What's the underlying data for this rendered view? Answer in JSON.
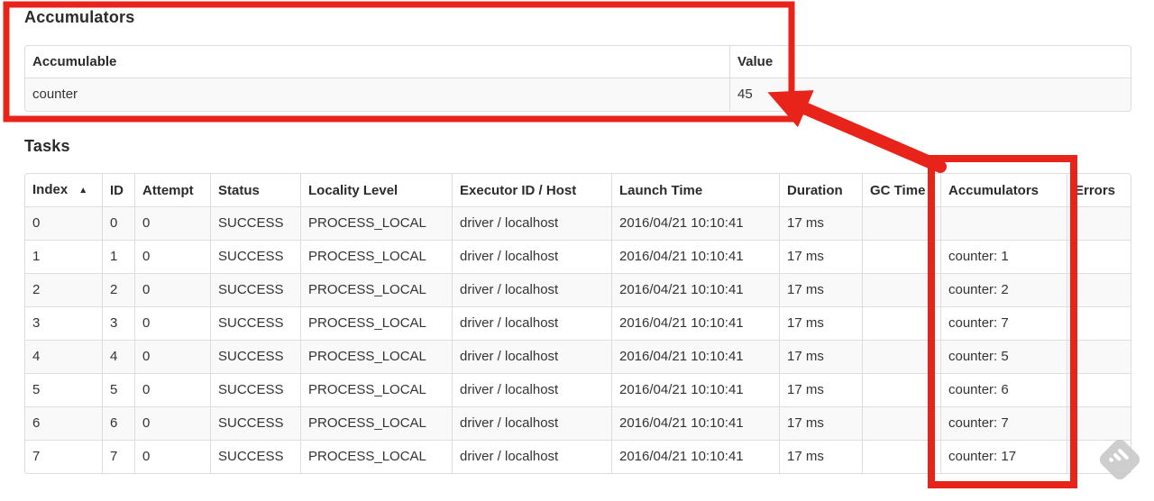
{
  "annotation": {
    "color": "#e8231a"
  },
  "accumulators_section": {
    "heading": "Accumulators",
    "columns": [
      "Accumulable",
      "Value"
    ],
    "rows": [
      {
        "accumulable": "counter",
        "value": "45"
      }
    ]
  },
  "tasks_section": {
    "heading": "Tasks",
    "columns": [
      "Index",
      "ID",
      "Attempt",
      "Status",
      "Locality Level",
      "Executor ID / Host",
      "Launch Time",
      "Duration",
      "GC Time",
      "Accumulators",
      "Errors"
    ],
    "sort_indicator": "▲",
    "rows": [
      {
        "index": "0",
        "id": "0",
        "attempt": "0",
        "status": "SUCCESS",
        "locality_level": "PROCESS_LOCAL",
        "executor_id_host": "driver / localhost",
        "launch_time": "2016/04/21 10:10:41",
        "duration": "17 ms",
        "gc_time": "",
        "accumulators": "",
        "errors": ""
      },
      {
        "index": "1",
        "id": "1",
        "attempt": "0",
        "status": "SUCCESS",
        "locality_level": "PROCESS_LOCAL",
        "executor_id_host": "driver / localhost",
        "launch_time": "2016/04/21 10:10:41",
        "duration": "17 ms",
        "gc_time": "",
        "accumulators": "counter: 1",
        "errors": ""
      },
      {
        "index": "2",
        "id": "2",
        "attempt": "0",
        "status": "SUCCESS",
        "locality_level": "PROCESS_LOCAL",
        "executor_id_host": "driver / localhost",
        "launch_time": "2016/04/21 10:10:41",
        "duration": "17 ms",
        "gc_time": "",
        "accumulators": "counter: 2",
        "errors": ""
      },
      {
        "index": "3",
        "id": "3",
        "attempt": "0",
        "status": "SUCCESS",
        "locality_level": "PROCESS_LOCAL",
        "executor_id_host": "driver / localhost",
        "launch_time": "2016/04/21 10:10:41",
        "duration": "17 ms",
        "gc_time": "",
        "accumulators": "counter: 7",
        "errors": ""
      },
      {
        "index": "4",
        "id": "4",
        "attempt": "0",
        "status": "SUCCESS",
        "locality_level": "PROCESS_LOCAL",
        "executor_id_host": "driver / localhost",
        "launch_time": "2016/04/21 10:10:41",
        "duration": "17 ms",
        "gc_time": "",
        "accumulators": "counter: 5",
        "errors": ""
      },
      {
        "index": "5",
        "id": "5",
        "attempt": "0",
        "status": "SUCCESS",
        "locality_level": "PROCESS_LOCAL",
        "executor_id_host": "driver / localhost",
        "launch_time": "2016/04/21 10:10:41",
        "duration": "17 ms",
        "gc_time": "",
        "accumulators": "counter: 6",
        "errors": ""
      },
      {
        "index": "6",
        "id": "6",
        "attempt": "0",
        "status": "SUCCESS",
        "locality_level": "PROCESS_LOCAL",
        "executor_id_host": "driver / localhost",
        "launch_time": "2016/04/21 10:10:41",
        "duration": "17 ms",
        "gc_time": "",
        "accumulators": "counter: 7",
        "errors": ""
      },
      {
        "index": "7",
        "id": "7",
        "attempt": "0",
        "status": "SUCCESS",
        "locality_level": "PROCESS_LOCAL",
        "executor_id_host": "driver / localhost",
        "launch_time": "2016/04/21 10:10:41",
        "duration": "17 ms",
        "gc_time": "",
        "accumulators": "counter: 17",
        "errors": ""
      }
    ]
  }
}
